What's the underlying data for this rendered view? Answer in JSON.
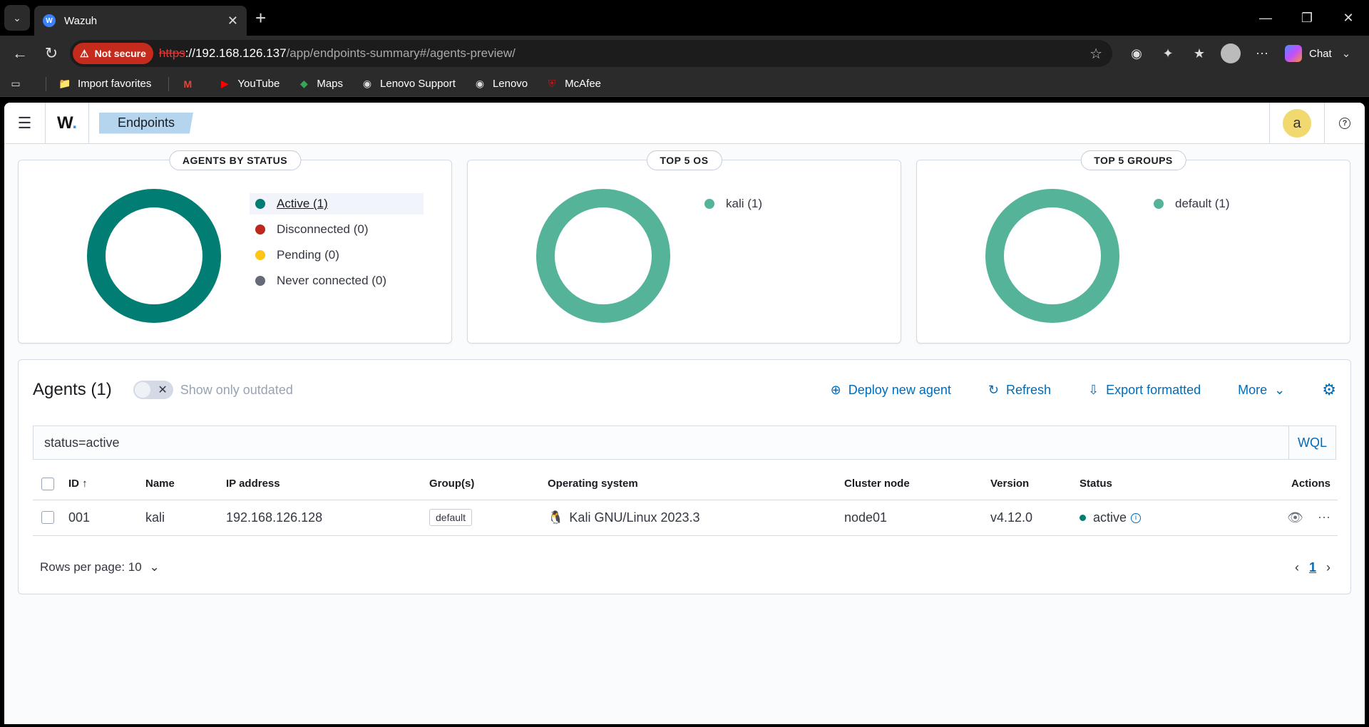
{
  "browser": {
    "tab_title": "Wazuh",
    "tab_favicon_letter": "W",
    "security_label": "Not secure",
    "url_scheme": "https",
    "url_host": "://192.168.126.137",
    "url_path": "/app/endpoints-summary#/agents-preview/",
    "chat_label": "Chat",
    "bookmarks": [
      {
        "label": "Import favorites",
        "icon": "folder-icon"
      },
      {
        "label": "",
        "icon": "gmail-icon"
      },
      {
        "label": "YouTube",
        "icon": "youtube-icon"
      },
      {
        "label": "Maps",
        "icon": "maps-icon"
      },
      {
        "label": "Lenovo Support",
        "icon": "globe-icon"
      },
      {
        "label": "Lenovo",
        "icon": "globe-icon"
      },
      {
        "label": "McAfee",
        "icon": "mcafee-icon"
      }
    ]
  },
  "app": {
    "logo_text": "W",
    "breadcrumb": "Endpoints",
    "user_initial": "a",
    "help_glyph": "?"
  },
  "panels": {
    "status": {
      "title": "AGENTS BY STATUS",
      "items": [
        {
          "label": "Active (1)",
          "color": "#017d73"
        },
        {
          "label": "Disconnected (0)",
          "color": "#bd271e"
        },
        {
          "label": "Pending (0)",
          "color": "#fec514"
        },
        {
          "label": "Never connected (0)",
          "color": "#646a77"
        }
      ]
    },
    "os": {
      "title": "TOP 5 OS",
      "items": [
        {
          "label": "kali (1)",
          "color": "#54b399"
        }
      ]
    },
    "groups": {
      "title": "TOP 5 GROUPS",
      "items": [
        {
          "label": "default (1)",
          "color": "#54b399"
        }
      ]
    }
  },
  "agents": {
    "title": "Agents (1)",
    "toggle_label": "Show only outdated",
    "actions": {
      "deploy": "Deploy new agent",
      "refresh": "Refresh",
      "export": "Export formatted",
      "more": "More"
    },
    "search_value": "status=active",
    "wql_label": "WQL",
    "columns": {
      "id": "ID",
      "name": "Name",
      "ip": "IP address",
      "groups": "Group(s)",
      "os": "Operating system",
      "node": "Cluster node",
      "version": "Version",
      "status": "Status",
      "actions": "Actions"
    },
    "rows": [
      {
        "id": "001",
        "name": "kali",
        "ip": "192.168.126.128",
        "group": "default",
        "os": "Kali GNU/Linux 2023.3",
        "node": "node01",
        "version": "v4.12.0",
        "status": "active"
      }
    ],
    "rows_per_page": "Rows per page: 10",
    "current_page": "1"
  }
}
